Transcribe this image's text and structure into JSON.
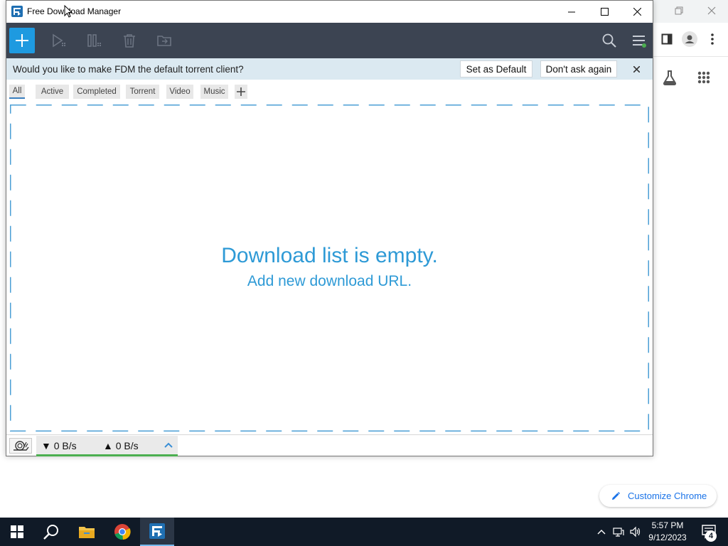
{
  "fdm": {
    "title": "Free Download Manager",
    "notice": {
      "text": "Would you like to make FDM the default torrent client?",
      "set_default": "Set as Default",
      "dont_ask": "Don't ask again"
    },
    "filters": [
      "All",
      "Active",
      "Completed",
      "Torrent",
      "Video",
      "Music"
    ],
    "active_filter": "All",
    "empty_title": "Download list is empty.",
    "empty_subtitle": "Add new download URL.",
    "status": {
      "download_speed": "0 B/s",
      "upload_speed": "0 B/s"
    }
  },
  "chrome": {
    "customize_label": "Customize Chrome"
  },
  "taskbar": {
    "time": "5:57 PM",
    "date": "9/12/2023",
    "notification_count": "4"
  },
  "colors": {
    "accent": "#1e9ae0",
    "toolbar": "#3c4452",
    "notice_bg": "#dbe9f1",
    "empty_text": "#2e9ad6",
    "speed_indicator": "#4caf50",
    "taskbar": "#101a27"
  },
  "icons": {
    "add": "plus-icon",
    "resume": "play-icon",
    "pause": "pause-icon",
    "delete": "trash-icon",
    "move": "folder-move-icon",
    "search": "search-icon",
    "menu": "hamburger-menu-icon",
    "snail": "snail-icon"
  }
}
